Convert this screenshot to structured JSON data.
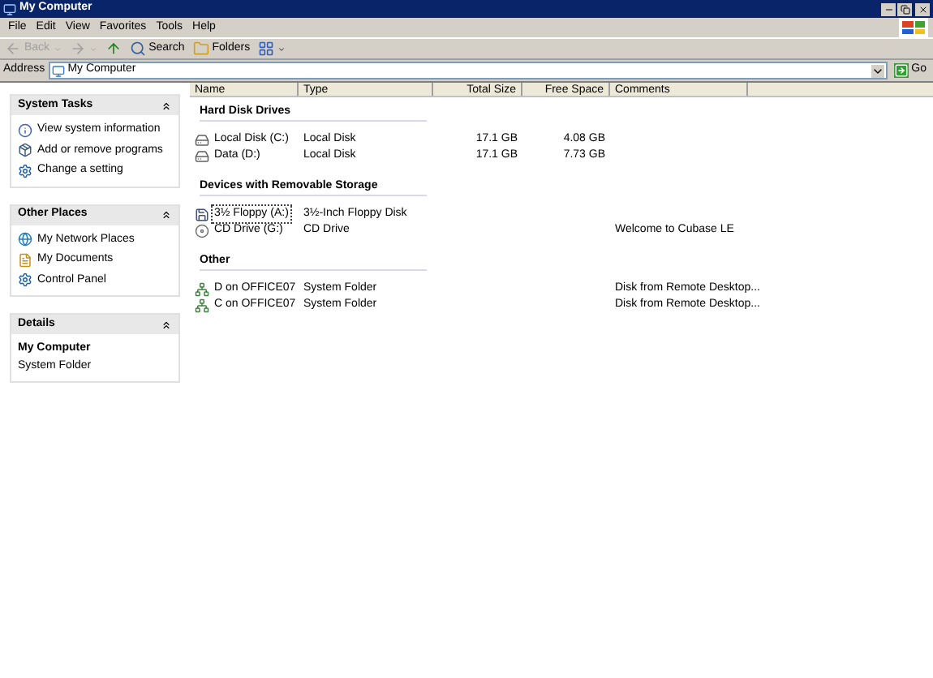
{
  "window": {
    "title": "My Computer"
  },
  "menu": [
    {
      "label": "File"
    },
    {
      "label": "Edit"
    },
    {
      "label": "View"
    },
    {
      "label": "Favorites"
    },
    {
      "label": "Tools"
    },
    {
      "label": "Help"
    }
  ],
  "toolbar": [
    {
      "kind": "back",
      "label": "Back",
      "disabled": true
    },
    {
      "kind": "forward",
      "disabled": true
    },
    {
      "kind": "up",
      "disabled": false
    },
    {
      "kind": "search",
      "label": "Search",
      "disabled": false
    },
    {
      "kind": "folders",
      "label": "Folders",
      "disabled": false
    },
    {
      "kind": "views",
      "disabled": false
    }
  ],
  "address": {
    "label": "Address",
    "value": "My Computer",
    "go": "Go"
  },
  "sidebar": [
    {
      "kind": "tasks",
      "title": "System Tasks",
      "expanded": true,
      "items": [
        {
          "label": "View system information",
          "kind": "info"
        },
        {
          "label": "Add or remove programs",
          "kind": "programs"
        },
        {
          "label": "Change a setting",
          "kind": "control"
        }
      ]
    },
    {
      "kind": "tasks",
      "title": "Other Places",
      "expanded": true,
      "items": [
        {
          "label": "My Network Places",
          "kind": "network"
        },
        {
          "label": "My Documents",
          "kind": "documents"
        },
        {
          "label": "Control Panel",
          "kind": "control"
        }
      ]
    },
    {
      "kind": "details",
      "title": "Details",
      "expanded": true,
      "name": "My Computer",
      "description": "System Folder"
    }
  ],
  "columns": [
    {
      "label": "Name"
    },
    {
      "label": "Type"
    },
    {
      "label": "Total Size"
    },
    {
      "label": "Free Space"
    },
    {
      "label": "Comments"
    }
  ],
  "groups": [
    {
      "title": "Hard Disk Drives",
      "rows": [
        {
          "name": "Local Disk (C:)",
          "kind": "disk",
          "type": "Local Disk",
          "total": "17.1 GB",
          "free": "4.08 GB",
          "selected": false
        },
        {
          "name": "Data (D:)",
          "kind": "disk",
          "type": "Local Disk",
          "total": "17.1 GB",
          "free": "7.73 GB",
          "selected": false
        }
      ]
    },
    {
      "title": "Devices with Removable Storage",
      "rows": [
        {
          "name": "3½ Floppy (A:)",
          "kind": "floppy",
          "type": "3½-Inch Floppy Disk",
          "selected": true
        },
        {
          "name": "CD Drive (G:)",
          "kind": "cd",
          "type": "CD Drive",
          "comment": "Welcome to Cubase LE",
          "selected": false
        }
      ]
    },
    {
      "title": "Other",
      "rows": [
        {
          "name": "D on OFFICE07",
          "kind": "share",
          "type": "System Folder",
          "comment": "Disk from Remote Desktop...",
          "selected": false
        },
        {
          "name": "C on OFFICE07",
          "kind": "share",
          "type": "System Folder",
          "comment": "Disk from Remote Desktop...",
          "selected": false
        }
      ]
    }
  ]
}
